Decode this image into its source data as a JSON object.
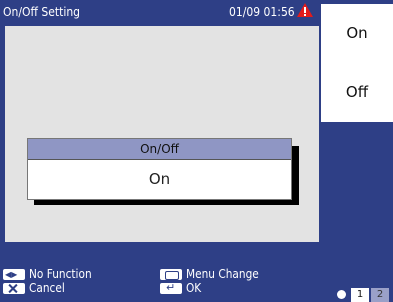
{
  "header": {
    "title": "On/Off Setting",
    "datetime": "01/09 01:56",
    "warning_icon": "warning-triangle-icon"
  },
  "dialog": {
    "title": "On/Off",
    "value": "On"
  },
  "side_buttons": [
    {
      "label": "On"
    },
    {
      "label": "Off"
    }
  ],
  "footer": {
    "no_function": "No Function",
    "cancel": "Cancel",
    "menu_change": "Menu Change",
    "ok": "OK"
  },
  "pager": {
    "current": "1",
    "next": "2"
  },
  "colors": {
    "background": "#2e3f86",
    "panel": "#e3e3e3",
    "dialog_header": "#8f96c4",
    "warning": "#e21b1b"
  }
}
